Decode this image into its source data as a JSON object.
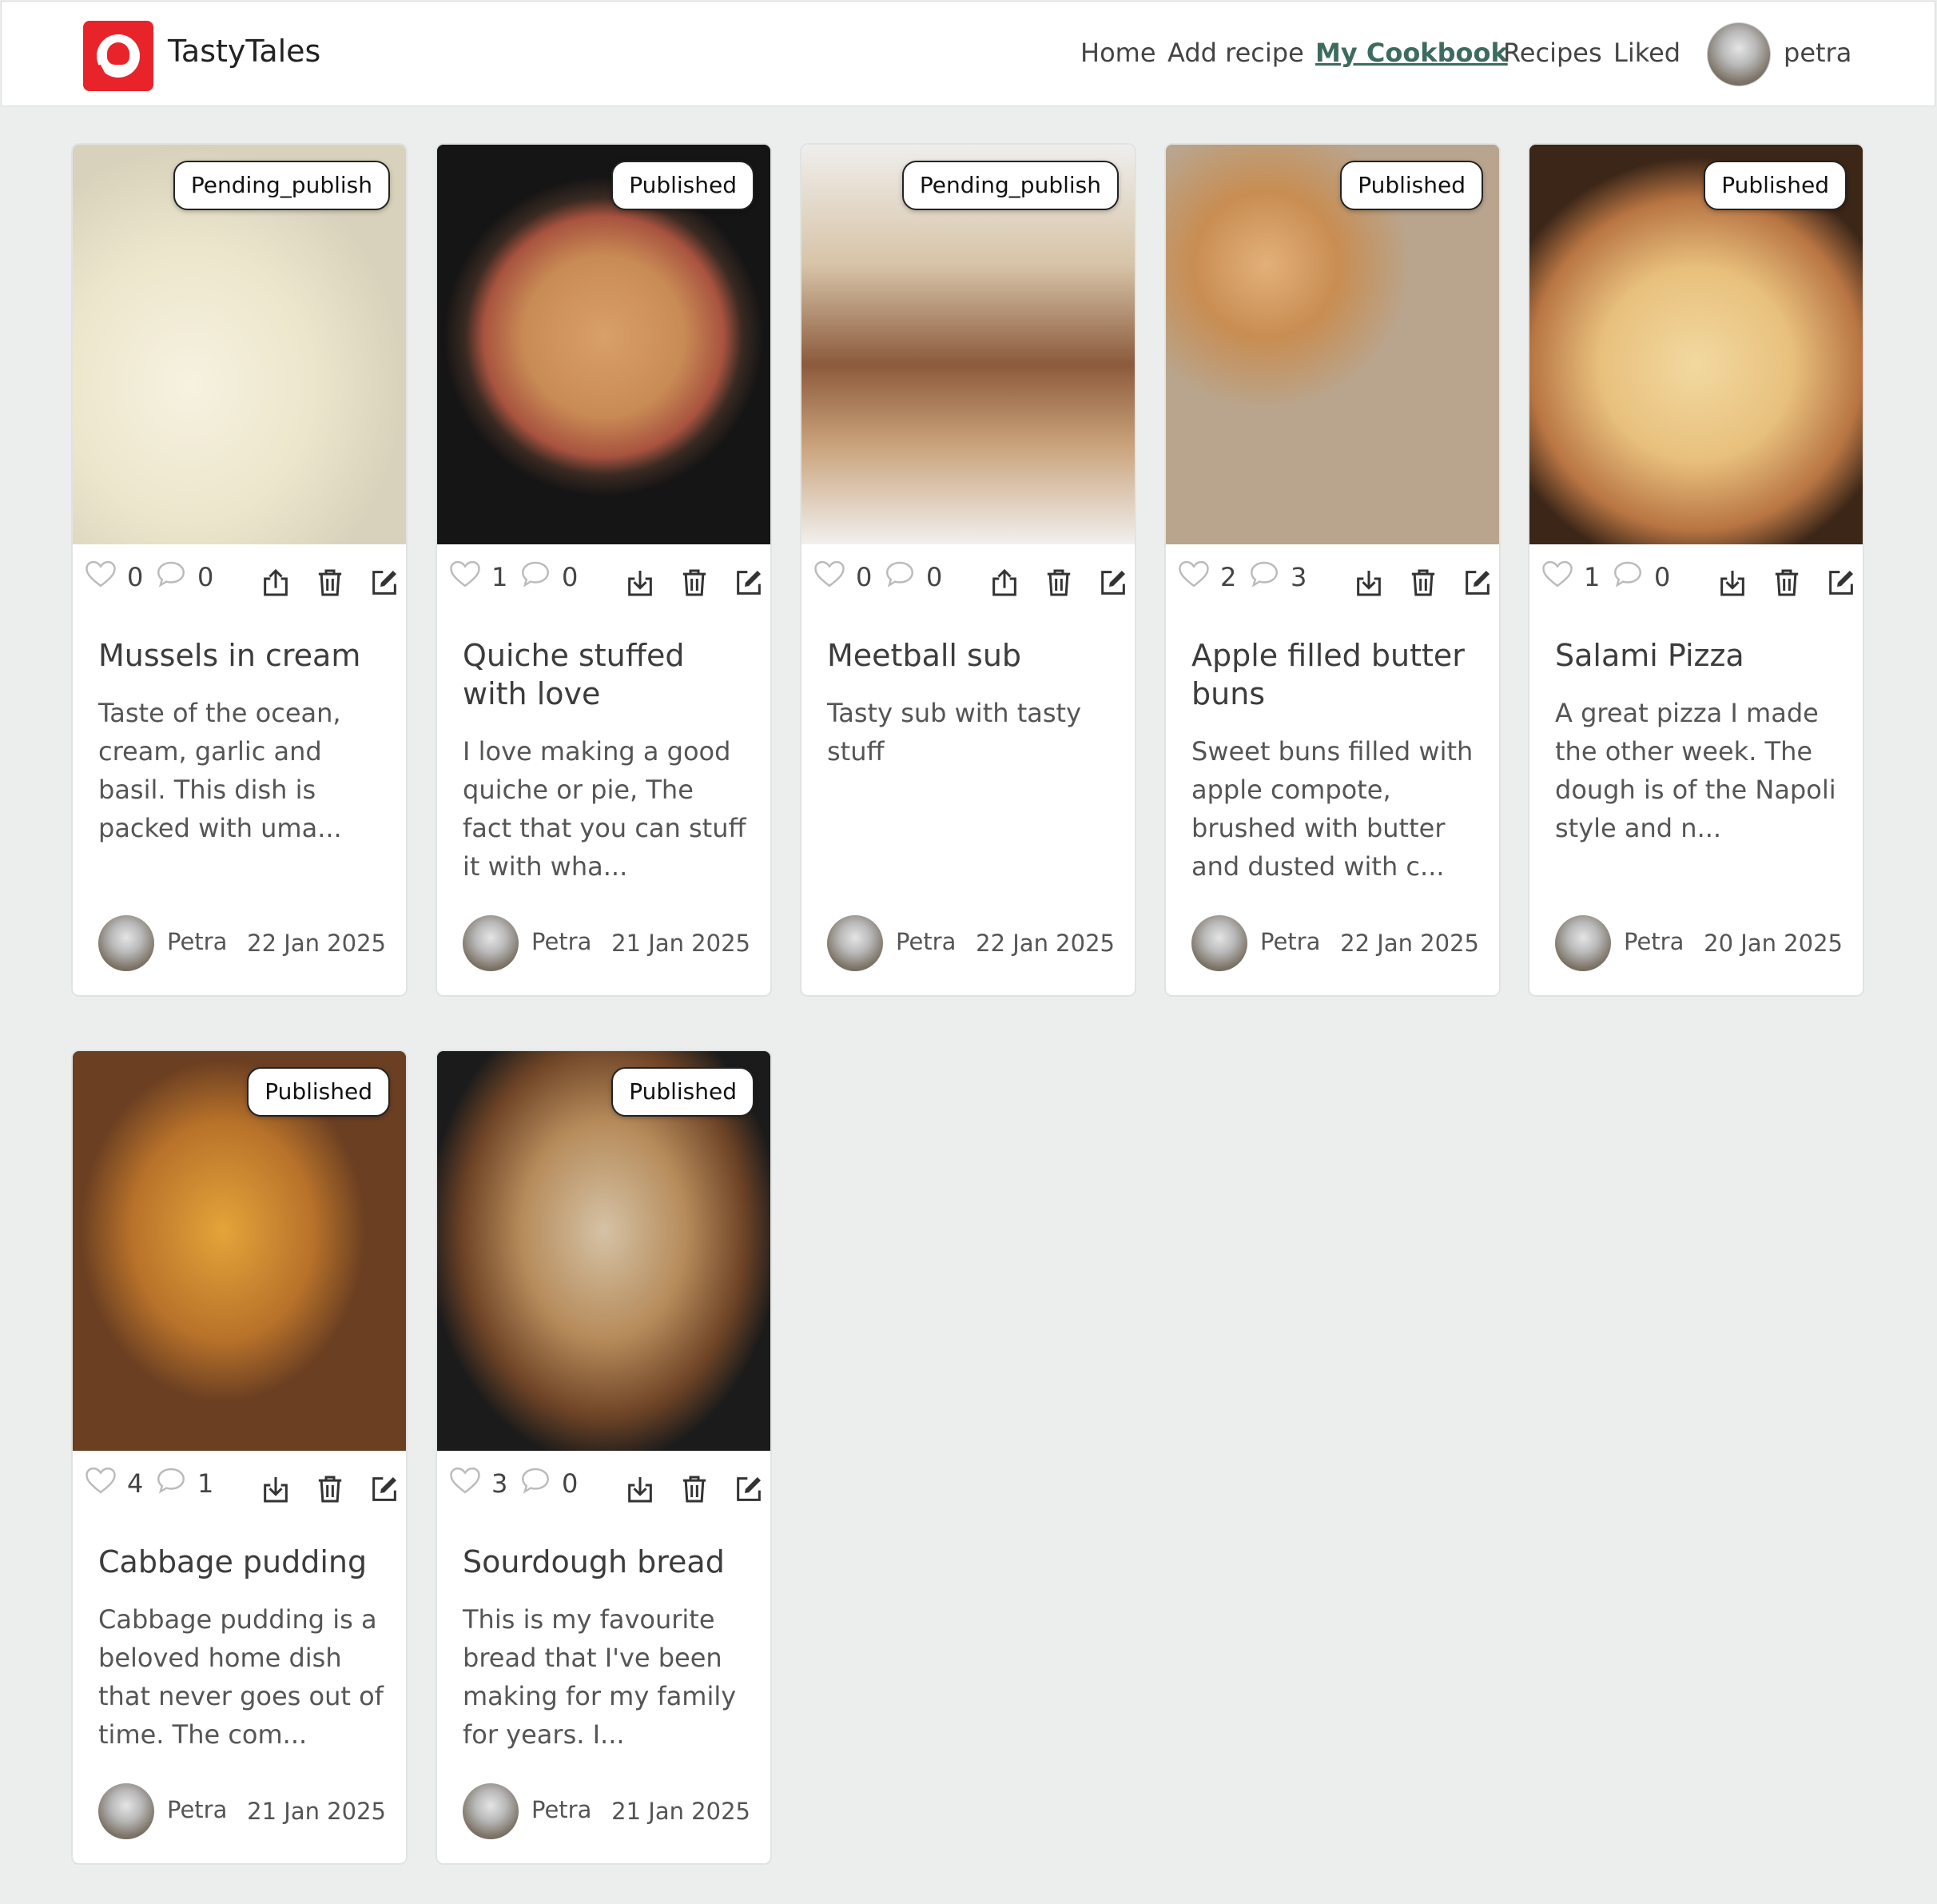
{
  "app": {
    "name": "TastyTales"
  },
  "nav": {
    "home": "Home",
    "add_recipe": "Add recipe",
    "my_cookbook": "My Cookbook",
    "recipes": "Recipes",
    "liked": "Liked"
  },
  "user": {
    "name": "petra"
  },
  "cards": [
    {
      "status": "Pending_publish",
      "likes": "0",
      "comments": "0",
      "title": "Mussels in cream",
      "description": "Taste of the ocean, cream, garlic and basil. This dish is packed with uma...",
      "author": "Petra",
      "date": "22 Jan 2025",
      "publish_action": "upload-icon"
    },
    {
      "status": "Published",
      "likes": "1",
      "comments": "0",
      "title": "Quiche stuffed with love",
      "description": "I love making a good quiche or pie, The fact that you can stuff it with wha...",
      "author": "Petra",
      "date": "21 Jan 2025",
      "publish_action": "download-icon"
    },
    {
      "status": "Pending_publish",
      "likes": "0",
      "comments": "0",
      "title": "Meetball sub",
      "description": "Tasty sub with tasty stuff",
      "author": "Petra",
      "date": "22 Jan 2025",
      "publish_action": "upload-icon"
    },
    {
      "status": "Published",
      "likes": "2",
      "comments": "3",
      "title": "Apple filled butter buns",
      "description": "Sweet buns filled with apple compote, brushed with butter and dusted with c...",
      "author": "Petra",
      "date": "22 Jan 2025",
      "publish_action": "download-icon"
    },
    {
      "status": "Published",
      "likes": "1",
      "comments": "0",
      "title": "Salami Pizza",
      "description": "A great pizza I made the other week. The dough is of the Napoli style and n...",
      "author": "Petra",
      "date": "20 Jan 2025",
      "publish_action": "download-icon"
    },
    {
      "status": "Published",
      "likes": "4",
      "comments": "1",
      "title": "Cabbage pudding",
      "description": "Cabbage pudding is a beloved home dish that never goes out of time. The com...",
      "author": "Petra",
      "date": "21 Jan 2025",
      "publish_action": "download-icon"
    },
    {
      "status": "Published",
      "likes": "3",
      "comments": "0",
      "title": "Sourdough bread",
      "description": "This is my favourite bread that I've been making for my family for years. I...",
      "author": "Petra",
      "date": "21 Jan 2025",
      "publish_action": "download-icon"
    }
  ],
  "colors": {
    "brand": "#e8242a",
    "accent": "#3d6b5f",
    "background": "#ebeeed"
  }
}
